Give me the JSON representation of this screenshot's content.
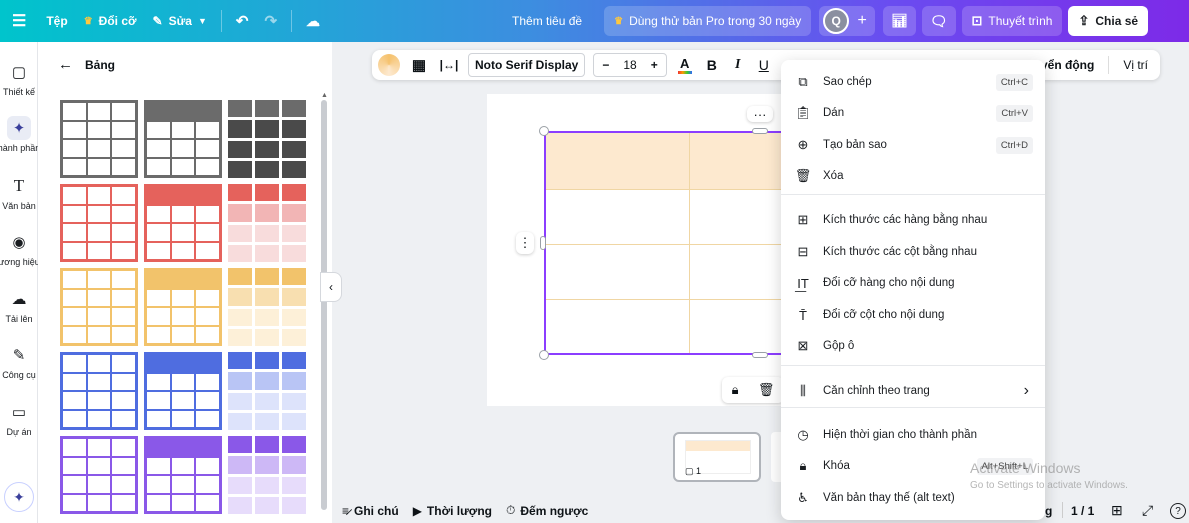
{
  "topbar": {
    "menu_icon": "hamburger-icon",
    "home": "Tệp",
    "resize": "Đổi cỡ",
    "edit": "Sửa",
    "doc_title": "Thêm tiêu đề",
    "pro_trial": "Dùng thử bản Pro trong 30 ngày",
    "avatar_letter": "Q",
    "present": "Thuyết trình",
    "share": "Chia sẻ"
  },
  "rail": {
    "items": [
      {
        "label": "Thiết kế",
        "icon": "layout-icon"
      },
      {
        "label": "hành phần",
        "icon": "elements-icon"
      },
      {
        "label": "Văn bản",
        "icon": "text-icon"
      },
      {
        "label": "ương hiệu",
        "icon": "brand-icon"
      },
      {
        "label": "Tải lên",
        "icon": "upload-icon"
      },
      {
        "label": "Công cụ",
        "icon": "tools-icon"
      },
      {
        "label": "Dự án",
        "icon": "folder-icon"
      }
    ]
  },
  "panel": {
    "title": "Bảng"
  },
  "toolbar": {
    "font": "Noto Serif Display",
    "size": "18",
    "minus": "−",
    "plus": "+",
    "animate": "uyển động",
    "position": "Vị trí"
  },
  "colors": {
    "gray": "#6b6b6b",
    "red": "#e5625c",
    "yellow": "#f2c36b",
    "blue": "#4f6de0",
    "purple": "#8a58e8",
    "accent": "#8b3dff",
    "header_fill": "#fde9cf"
  },
  "menu": {
    "items": [
      {
        "label": "Sao chép",
        "shortcut": "Ctrl+C",
        "icon": "copy-icon"
      },
      {
        "label": "Dán",
        "shortcut": "Ctrl+V",
        "icon": "paste-icon"
      },
      {
        "label": "Tạo bản sao",
        "shortcut": "Ctrl+D",
        "icon": "duplicate-icon"
      },
      {
        "label": "Xóa",
        "shortcut": "",
        "icon": "trash-icon"
      },
      {
        "label": "Kích thước các hàng bằng nhau",
        "shortcut": "",
        "icon": "equal-rows-icon"
      },
      {
        "label": "Kích thước các cột bằng nhau",
        "shortcut": "",
        "icon": "equal-columns-icon"
      },
      {
        "label": "Đổi cỡ hàng cho nội dung",
        "shortcut": "",
        "icon": "fit-row-icon"
      },
      {
        "label": "Đổi cỡ cột cho nội dung",
        "shortcut": "",
        "icon": "fit-column-icon"
      },
      {
        "label": "Gộp ô",
        "shortcut": "",
        "icon": "merge-cells-icon"
      },
      {
        "label": "Căn chỉnh theo trang",
        "shortcut": "",
        "icon": "align-icon"
      },
      {
        "label": "Hiện thời gian cho thành phần",
        "shortcut": "",
        "icon": "clock-icon"
      },
      {
        "label": "Khóa",
        "shortcut": "Alt+Shift+L",
        "icon": "lock-icon"
      },
      {
        "label": "Văn bản thay thế (alt text)",
        "shortcut": "",
        "icon": "accessibility-icon"
      }
    ]
  },
  "bottom": {
    "notes": "Ghi chú",
    "duration": "Thời lượng",
    "timer": "Đếm ngược",
    "page_count": "1 / 1",
    "thumb_number": "1",
    "zoom_tail": "g"
  },
  "watermark": {
    "line1": "Activate Windows",
    "line2": "Go to Settings to activate Windows."
  }
}
